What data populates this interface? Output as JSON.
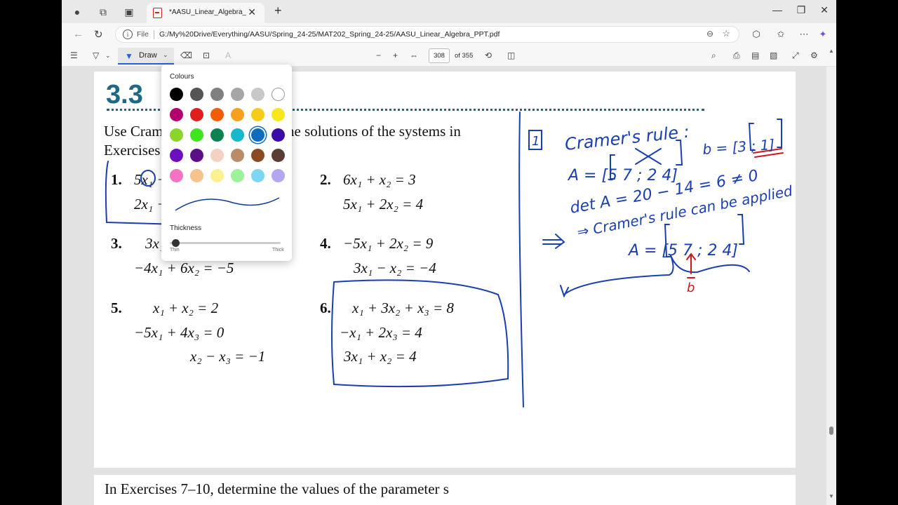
{
  "browser": {
    "tab_title": "*AASU_Linear_Algebra_PPT",
    "file_label": "File",
    "url": "G:/My%20Drive/Everything/AASU/Spring_24-25/MAT202_Spring_24-25/AASU_Linear_Algebra_PPT.pdf"
  },
  "pdf_toolbar": {
    "draw_label": "Draw",
    "page_number": "308",
    "page_total": "of 355"
  },
  "colour_panel": {
    "title": "Colours",
    "thickness_label": "Thickness",
    "thin_label": "Thin",
    "thick_label": "Thick",
    "thickness_value": 0.02,
    "selected_colour": "#0f6cbd",
    "colours": [
      "#000000",
      "#555555",
      "#808080",
      "#a6a6a6",
      "#c8c8c8",
      "#ffffff",
      "#b4006e",
      "#e11d1d",
      "#f25c05",
      "#f7a01d",
      "#f5cc1b",
      "#f8e71c",
      "#8bd42a",
      "#3fe41f",
      "#0f8050",
      "#16b8cc",
      "#0f6cbd",
      "#3c0ca8",
      "#6b0fbf",
      "#5c0e87",
      "#f5d1c4",
      "#b98b68",
      "#8a4b22",
      "#5a3d33",
      "#f373c4",
      "#f6c28e",
      "#fbf190",
      "#9cf299",
      "#7ed7f2",
      "#b5a6f2"
    ]
  },
  "document": {
    "section_number": "3.3",
    "instruction_line1": "Use Cramer's rule to compute the solutions of the systems in",
    "instruction_line2": "Exercises 1–6.",
    "exercises": [
      {
        "num": "1.",
        "lines": [
          "5x₁ + 7x₂ = 3",
          "2x₁ + 4x₂ = 1"
        ]
      },
      {
        "num": "2.",
        "lines": [
          "6x₁ +   x₂ = 3",
          "5x₁ + 2x₂ = 4"
        ]
      },
      {
        "num": "3.",
        "lines": [
          "3x₁ − 2x₂ = 7",
          "−4x₁ + 6x₂ = −5"
        ]
      },
      {
        "num": "4.",
        "lines": [
          "−5x₁ + 2x₂ =   9",
          "3x₁ −   x₂ = −4"
        ]
      },
      {
        "num": "5.",
        "lines": [
          "x₁ + x₂           =   2",
          "−5x₁         + 4x₃ =   0",
          "x₂ −   x₃ = −1"
        ]
      },
      {
        "num": "6.",
        "lines": [
          "x₁ + 3x₂ +   x₃ = 8",
          "−x₁ +           2x₃ = 4",
          "3x₁ +   x₂           = 4"
        ]
      }
    ],
    "next_block_line1": "In Exercises 7–10, determine the values of the parameter s"
  },
  "annotations": {
    "box_number": "1",
    "cramers_rule": "Cramer's rule :",
    "matrix_a_line": "A = [5 7 ; 2 4]",
    "b_vector": "b = [3 ; 1]",
    "det_line": "det A = 20 − 14 = 6 ≠ 0",
    "applied_line": "⇒ Cramer's rule can be applied",
    "a_again": "A = [5 7 ; 2 4]",
    "b_label": "b"
  }
}
